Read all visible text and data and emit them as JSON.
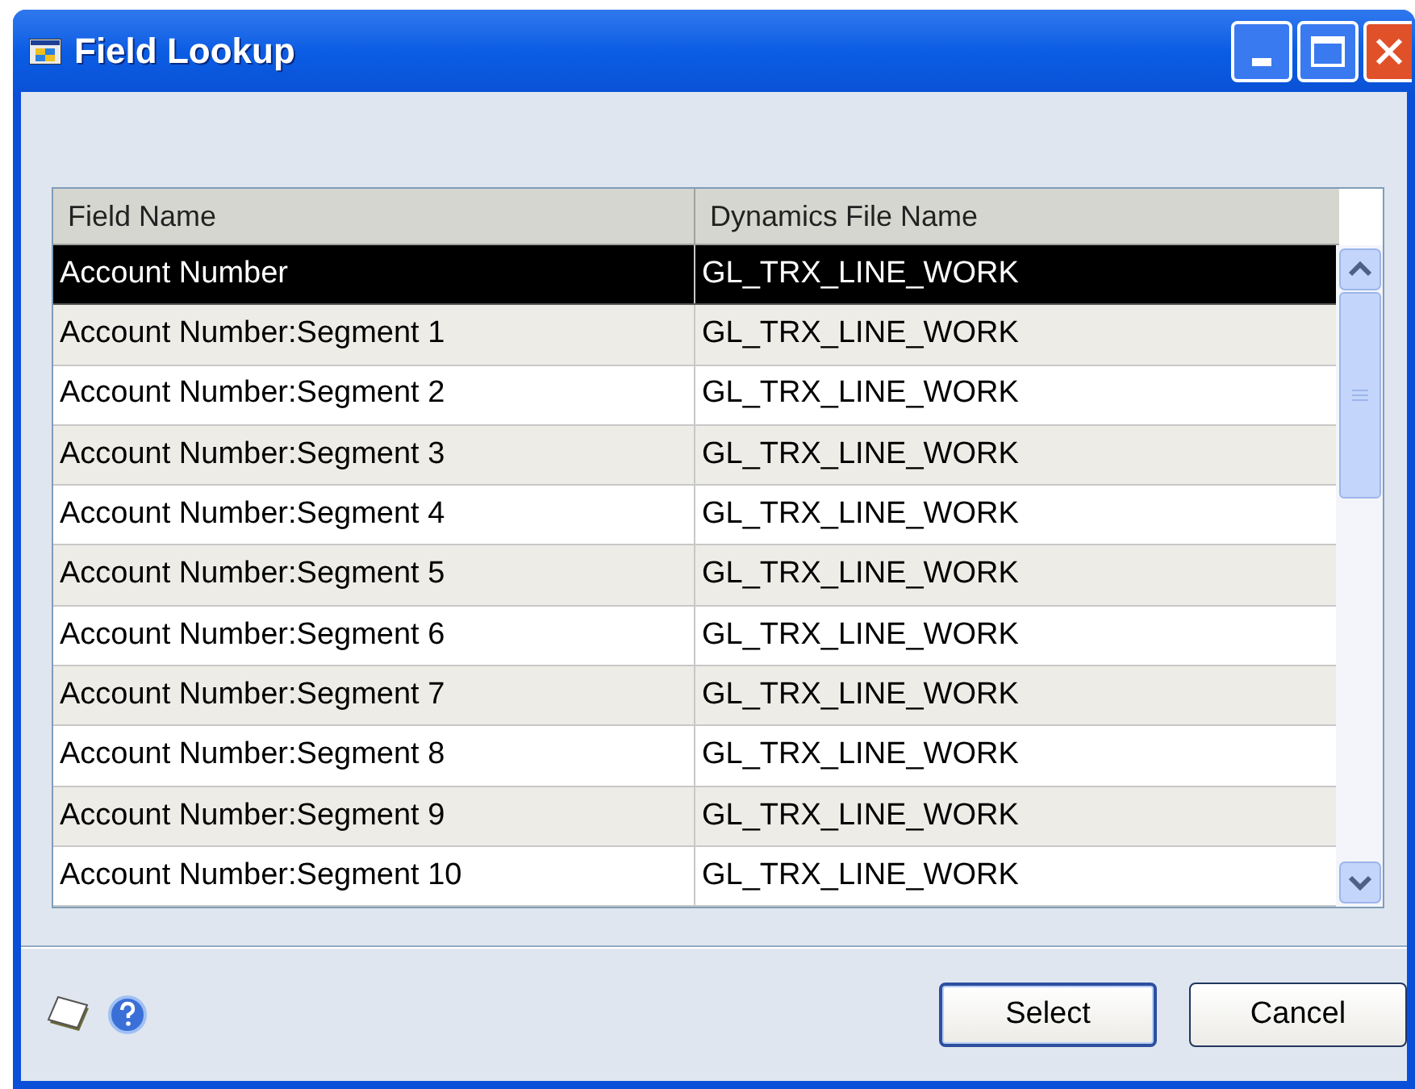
{
  "window": {
    "title": "Field Lookup"
  },
  "table": {
    "columns": [
      "Field Name",
      "Dynamics File Name"
    ],
    "rows": [
      {
        "cells": [
          "Account Number",
          "GL_TRX_LINE_WORK"
        ],
        "selected": true
      },
      {
        "cells": [
          "Account Number:Segment 1",
          "GL_TRX_LINE_WORK"
        ],
        "selected": false
      },
      {
        "cells": [
          "Account Number:Segment 2",
          "GL_TRX_LINE_WORK"
        ],
        "selected": false
      },
      {
        "cells": [
          "Account Number:Segment 3",
          "GL_TRX_LINE_WORK"
        ],
        "selected": false
      },
      {
        "cells": [
          "Account Number:Segment 4",
          "GL_TRX_LINE_WORK"
        ],
        "selected": false
      },
      {
        "cells": [
          "Account Number:Segment 5",
          "GL_TRX_LINE_WORK"
        ],
        "selected": false
      },
      {
        "cells": [
          "Account Number:Segment 6",
          "GL_TRX_LINE_WORK"
        ],
        "selected": false
      },
      {
        "cells": [
          "Account Number:Segment 7",
          "GL_TRX_LINE_WORK"
        ],
        "selected": false
      },
      {
        "cells": [
          "Account Number:Segment 8",
          "GL_TRX_LINE_WORK"
        ],
        "selected": false
      },
      {
        "cells": [
          "Account Number:Segment 9",
          "GL_TRX_LINE_WORK"
        ],
        "selected": false
      },
      {
        "cells": [
          "Account Number:Segment 10",
          "GL_TRX_LINE_WORK"
        ],
        "selected": false
      }
    ]
  },
  "buttons": [
    {
      "label": "Select",
      "default": true
    },
    {
      "label": "Cancel",
      "default": false
    }
  ]
}
